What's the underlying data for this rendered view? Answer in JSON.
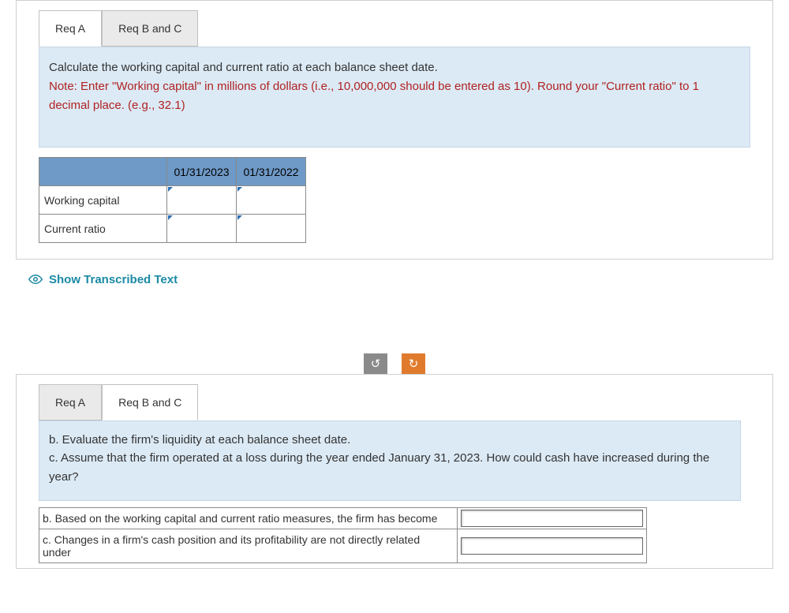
{
  "panel1": {
    "tabs": {
      "a": "Req A",
      "b": "Req B and C"
    },
    "prompt_main": "Calculate the working capital and current ratio at each balance sheet date.",
    "prompt_note": "Note: Enter \"Working capital\" in millions of dollars (i.e., 10,000,000 should be entered as 10). Round your \"Current ratio\" to 1 decimal place. (e.g., 32.1)",
    "cols": [
      "01/31/2023",
      "01/31/2022"
    ],
    "rows": [
      "Working capital",
      "Current ratio"
    ]
  },
  "show_transcribed": "Show Transcribed Text",
  "rotate_left_glyph": "↺",
  "rotate_right_glyph": "↻",
  "panel2": {
    "tabs": {
      "a": "Req A",
      "b": "Req B and C"
    },
    "prompt_b": "b. Evaluate the firm's liquidity at each balance sheet date.",
    "prompt_c": "c. Assume that the firm operated at a loss during the year ended January 31, 2023. How could cash have increased during the year?",
    "row_b": "b. Based on the working capital and current ratio measures, the firm has become",
    "row_c": "c. Changes in a firm's cash position and its profitability are not directly related under"
  }
}
